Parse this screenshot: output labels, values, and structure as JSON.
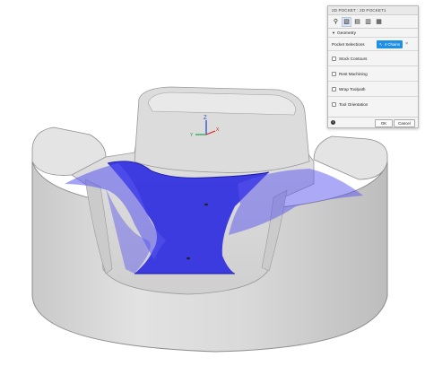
{
  "dialog": {
    "title": "2D POCKET : 2D POCKET1",
    "tabs": [
      {
        "icon": "tool-icon",
        "glyph": "⚲"
      },
      {
        "icon": "geometry-icon",
        "glyph": "▧"
      },
      {
        "icon": "heights-icon",
        "glyph": "▤"
      },
      {
        "icon": "passes-icon",
        "glyph": "▥"
      },
      {
        "icon": "linking-icon",
        "glyph": "▦"
      }
    ],
    "geometry_section": "Geometry",
    "pocket_selections_label": "Pocket Selections",
    "chains_value": "4 Chains",
    "checkboxes": [
      {
        "label": "Stock Contours",
        "checked": false
      },
      {
        "label": "Rest Machining",
        "checked": false
      },
      {
        "label": "Wrap Toolpath",
        "checked": false
      },
      {
        "label": "Tool Orientation",
        "checked": false
      }
    ],
    "ok_label": "OK",
    "cancel_label": "Cancel"
  },
  "axis_labels": {
    "z": "Z",
    "x": "X",
    "y": "Y"
  },
  "colors": {
    "selection_blue": "#2f2ee0",
    "selection_transparent": "#5a55f0",
    "part_gray": "#d6d6d6",
    "chains_button": "#1f8fe5"
  }
}
